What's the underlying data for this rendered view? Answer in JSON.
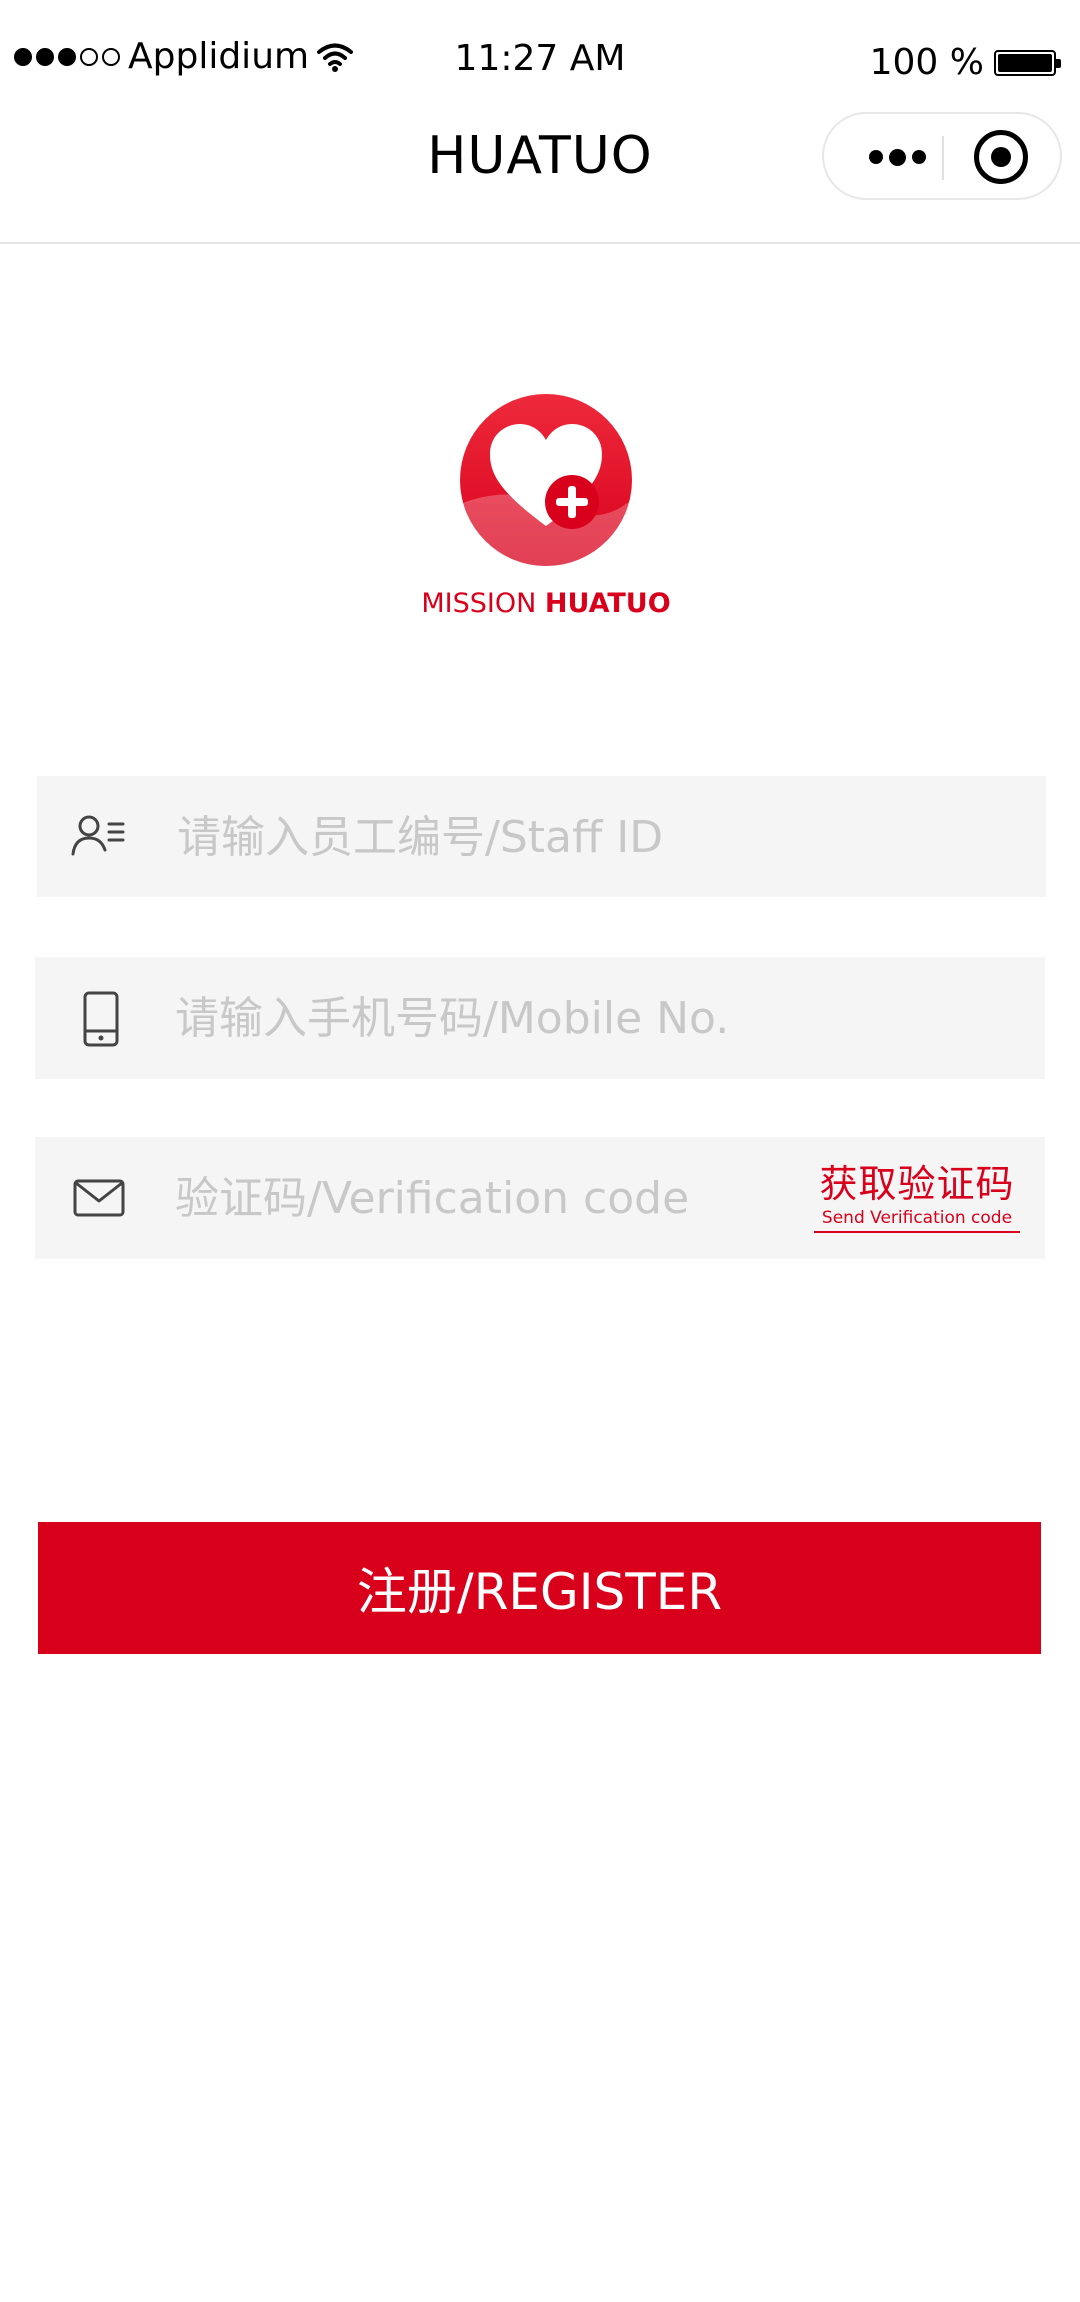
{
  "status_bar": {
    "carrier": "Applidium",
    "time": "11:27 AM",
    "battery_text": "100 %",
    "battery_level": 1.0
  },
  "nav": {
    "title": "HUATUO"
  },
  "brand": {
    "prefix": "MISSION",
    "name": "HUATUO",
    "color": "#d9001b"
  },
  "form": {
    "staff_id": {
      "placeholder": "请输入员工编号/Staff ID",
      "value": ""
    },
    "mobile": {
      "placeholder": "请输入手机号码/Mobile No.",
      "value": ""
    },
    "code": {
      "placeholder": "验证码/Verification code",
      "value": ""
    },
    "send_code_zh": "获取验证码",
    "send_code_en": "Send Verification code"
  },
  "register_label": "注册/REGISTER",
  "icons": {
    "signal": "signal-dots-icon",
    "wifi": "wifi-icon",
    "battery": "battery-icon",
    "more": "more-dots-icon",
    "close": "target-close-icon",
    "logo": "heart-cross-logo",
    "staff": "user-list-icon",
    "mobile": "mobile-phone-icon",
    "code": "envelope-icon"
  }
}
